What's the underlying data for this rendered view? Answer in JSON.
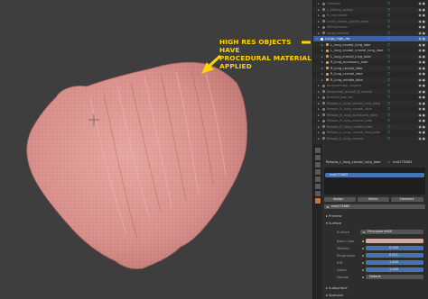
{
  "annotation": {
    "line1": "HIGH RES OBJECTS HAVE",
    "line2": "PROCEDURAL MATERIAL APPLIED"
  },
  "outliner": {
    "rows": [
      {
        "label": "Ureagmi",
        "state": "dim"
      },
      {
        "label": "L_kidney_cortex",
        "state": "dim"
      },
      {
        "label": "R_tracheostr",
        "state": "dim"
      },
      {
        "label": "Lcrdt_cortex_contral_mes",
        "state": "dim"
      },
      {
        "label": "Wrthgrnasus",
        "state": "dim"
      },
      {
        "label": "lungs_bhslow",
        "state": "dim"
      },
      {
        "label": "Lungs_high_res",
        "state": "sel"
      },
      {
        "label": "L_lung_caudal_lung_lobe",
        "state": "normal"
      },
      {
        "label": "L_lung_caudal_cranial_lung_lobe",
        "state": "normal"
      },
      {
        "label": "L_lung_cranial_lung_lobe",
        "state": "normal"
      },
      {
        "label": "R_lung_accessory_lobe",
        "state": "normal"
      },
      {
        "label": "R_lung_caudal_lobe",
        "state": "normal"
      },
      {
        "label": "R_lung_cranial_lobe",
        "state": "normal"
      },
      {
        "label": "R_lung_middle_lobe",
        "state": "normal"
      },
      {
        "label": "lungcomhigh_Organs",
        "state": "dim"
      },
      {
        "label": "diaschedo_alveoli_&_cranial",
        "state": "dim"
      },
      {
        "label": "Bronchi_low_res",
        "state": "dim"
      },
      {
        "label": "Retopo_L_lung_caudal_lung_lobe",
        "state": "dim"
      },
      {
        "label": "Retopo_R_lung_caudal_lobe",
        "state": "dim"
      },
      {
        "label": "Retopo_R_lung_accessory_lobe",
        "state": "dim"
      },
      {
        "label": "Retopo_R_lung_cranial_lobe",
        "state": "dim"
      },
      {
        "label": "Retopo_R_lung_middle_lobe",
        "state": "dim"
      },
      {
        "label": "Retopo_L_lung_cranial_lung_lobe",
        "state": "dim"
      },
      {
        "label": "Retopo_L_lung_cranial",
        "state": "dim"
      }
    ]
  },
  "properties": {
    "breadcrumb": "Retopo_L_lung_caudal_lung_lobe",
    "breadcrumb_mat": "mat175683",
    "slot_name": "mat175683",
    "assign": "Assign",
    "select": "Select",
    "deselect": "Deselect",
    "material_name": "mat175683",
    "preview": "Preview",
    "surface_header": "Surface",
    "surface_label": "Surface",
    "surface_value": "Principled BSDF",
    "rows": [
      {
        "label": "Base Color",
        "value": "",
        "kind": "color"
      },
      {
        "label": "Metallic",
        "value": "0.000",
        "kind": "blue"
      },
      {
        "label": "Roughness",
        "value": "0.511",
        "kind": "blue"
      },
      {
        "label": "IOR",
        "value": "1.450",
        "kind": "blue"
      },
      {
        "label": "Alpha",
        "value": "1.000",
        "kind": "blue"
      },
      {
        "label": "Normal",
        "value": "Default",
        "kind": "plain"
      }
    ],
    "subsurface": "Subsurface",
    "specular": "Specular"
  },
  "colors": {
    "accent": "#4772b3",
    "annotation": "#ffd400",
    "base_color": "#d9a7a0"
  }
}
